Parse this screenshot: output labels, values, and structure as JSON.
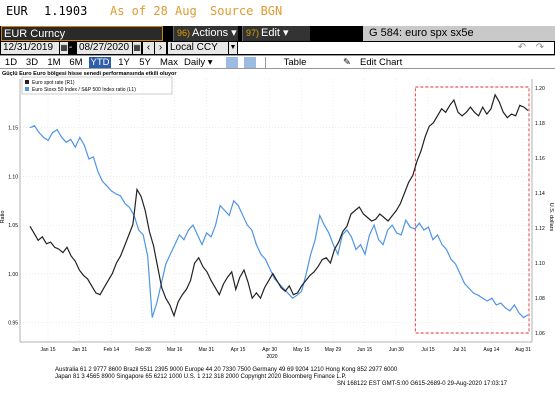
{
  "ticker": {
    "symbol": "EUR",
    "price": "1.1903",
    "asof": "As of 28 Aug",
    "source": "Source BGN"
  },
  "toolbar": {
    "security": "EUR Curncy",
    "actions": {
      "num": "96)",
      "label": "Actions ▾"
    },
    "edit": {
      "num": "97)",
      "label": "Edit ▾"
    },
    "page_title": "G 584: euro spx sx5e"
  },
  "controls": {
    "start_date": "12/31/2019",
    "end_date": "08/27/2020",
    "currency": "Local CCY"
  },
  "ranges": [
    "1D",
    "3D",
    "1M",
    "6M",
    "YTD",
    "1Y",
    "5Y",
    "Max"
  ],
  "active_range": "YTD",
  "frequency": "Daily ▾",
  "table_label": "Table",
  "edit_chart_label": "Edit Chart",
  "chart_title": "Güçlü Euro Euro bölgesi hisse senedi performansında etkili oluyor",
  "colors": {
    "euro": "#222222",
    "ratio": "#4f94e8",
    "highlight": "#e03030"
  },
  "footer": {
    "line1": "Australia 61 2 9777 8600  Brazil 5511 2395 9000  Europe 44 20 7330 7500  Germany 49 69 9204 1210  Hong Kong 852 2977 6000",
    "line2": "Japan 81 3 4565 8900        Singapore 65 6212 1000        U.S. 1 212 318 2000        Copyright 2020 Bloomberg Finance L.P.",
    "line3": "SN 168122 EST  GMT-5:00 G615-2689-0 29-Aug-2020 17:03:17"
  },
  "chart_data": {
    "type": "line",
    "title": "Güçlü Euro Euro bölgesi hisse senedi performansında etkili oluyor",
    "xlabel": "",
    "ylabel_left": "Ratio",
    "ylabel_right": "U.S. dollars",
    "x_ticks": [
      "Jan 15",
      "Jan 31",
      "Feb 14",
      "Feb 28",
      "Mar 16",
      "Mar 31",
      "Apr 15",
      "Apr 30",
      "May 15",
      "May 29",
      "Jun 15",
      "Jun 30",
      "Jul 15",
      "Jul 31",
      "Aug 14",
      "Aug 31"
    ],
    "x_year_label": "2020",
    "left_ticks": [
      "0.95",
      "1.00",
      "1.05",
      "1.10",
      "1.15"
    ],
    "left_ylim": [
      0.93,
      1.2
    ],
    "right_ticks": [
      "1.06",
      "1.08",
      "1.10",
      "1.12",
      "1.14",
      "1.16",
      "1.18",
      "1.20"
    ],
    "right_ylim": [
      1.055,
      1.205
    ],
    "legend_position": "top-left",
    "highlight_box": {
      "from": "Jul 9",
      "to": "Aug 31"
    },
    "series": [
      {
        "name": "Euro spot rate (R1)",
        "axis": "right",
        "values": [
          1.121,
          1.117,
          1.113,
          1.115,
          1.111,
          1.112,
          1.109,
          1.108,
          1.106,
          1.109,
          1.104,
          1.101,
          1.096,
          1.093,
          1.091,
          1.087,
          1.083,
          1.082,
          1.086,
          1.09,
          1.094,
          1.1,
          1.104,
          1.11,
          1.116,
          1.122,
          1.142,
          1.138,
          1.13,
          1.118,
          1.11,
          1.098,
          1.086,
          1.08,
          1.076,
          1.07,
          1.078,
          1.082,
          1.085,
          1.09,
          1.1,
          1.103,
          1.098,
          1.095,
          1.09,
          1.086,
          1.082,
          1.088,
          1.092,
          1.095,
          1.085,
          1.092,
          1.096,
          1.089,
          1.08,
          1.083,
          1.08,
          1.086,
          1.09,
          1.094,
          1.09,
          1.086,
          1.084,
          1.087,
          1.082,
          1.083,
          1.087,
          1.09,
          1.093,
          1.095,
          1.098,
          1.102,
          1.103,
          1.1,
          1.108,
          1.112,
          1.118,
          1.121,
          1.128,
          1.13,
          1.132,
          1.128,
          1.126,
          1.124,
          1.125,
          1.128,
          1.126,
          1.124,
          1.127,
          1.13,
          1.134,
          1.14,
          1.146,
          1.15,
          1.158,
          1.164,
          1.172,
          1.178,
          1.18,
          1.184,
          1.188,
          1.186,
          1.19,
          1.193,
          1.186,
          1.184,
          1.186,
          1.189,
          1.186,
          1.184,
          1.189,
          1.185,
          1.188,
          1.196,
          1.192,
          1.186,
          1.183,
          1.185,
          1.184,
          1.19,
          1.189,
          1.187
        ]
      },
      {
        "name": "Euro Stoxx 50 Index / S&P 500 Index ratio (L1)",
        "axis": "left",
        "values": [
          1.15,
          1.152,
          1.145,
          1.14,
          1.137,
          1.145,
          1.148,
          1.14,
          1.135,
          1.138,
          1.13,
          1.14,
          1.132,
          1.118,
          1.12,
          1.105,
          1.095,
          1.09,
          1.085,
          1.082,
          1.08,
          1.072,
          1.068,
          1.06,
          1.045,
          1.04,
          1.018,
          0.955,
          0.97,
          0.99,
          1.01,
          1.02,
          1.03,
          1.04,
          1.035,
          1.045,
          1.05,
          1.04,
          1.03,
          1.042,
          1.038,
          1.05,
          1.07,
          1.065,
          1.06,
          1.075,
          1.07,
          1.06,
          1.05,
          1.045,
          1.03,
          1.02,
          1.015,
          1.005,
          0.995,
          0.99,
          0.985,
          0.98,
          0.975,
          0.978,
          0.982,
          1.0,
          1.02,
          1.035,
          1.06,
          1.05,
          1.042,
          1.03,
          1.02,
          1.04,
          1.045,
          1.038,
          1.025,
          1.03,
          1.02,
          1.04,
          1.05,
          1.035,
          1.03,
          1.045,
          1.05,
          1.042,
          1.04,
          1.055,
          1.048,
          1.046,
          1.052,
          1.045,
          1.048,
          1.035,
          1.04,
          1.03,
          1.025,
          1.015,
          1.01,
          1.0,
          0.99,
          0.985,
          0.98,
          0.978,
          0.975,
          0.972,
          0.975,
          0.968,
          0.97,
          0.965,
          0.962,
          0.968,
          0.96,
          0.955,
          0.958
        ]
      }
    ]
  }
}
